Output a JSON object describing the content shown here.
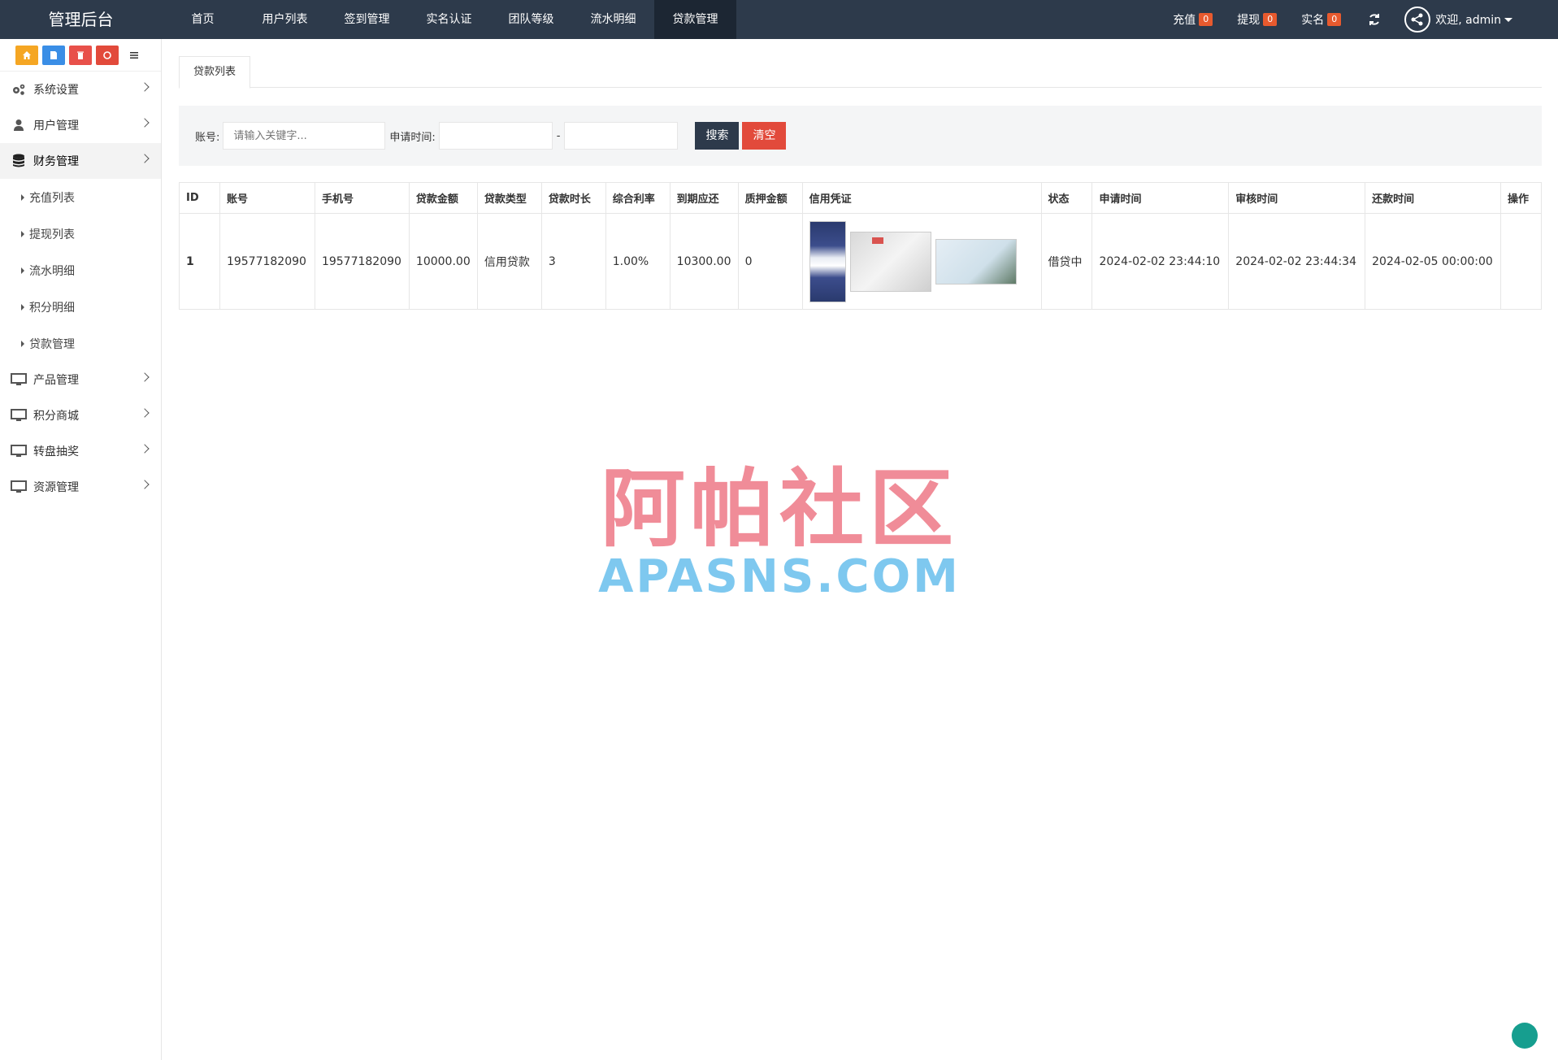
{
  "app": {
    "title": "管理后台"
  },
  "topnav": [
    {
      "label": "首页"
    },
    {
      "label": "用户列表"
    },
    {
      "label": "签到管理"
    },
    {
      "label": "实名认证"
    },
    {
      "label": "团队等级"
    },
    {
      "label": "流水明细"
    },
    {
      "label": "贷款管理",
      "active": true
    }
  ],
  "stats": [
    {
      "label": "充值",
      "count": "0"
    },
    {
      "label": "提现",
      "count": "0"
    },
    {
      "label": "实名",
      "count": "0"
    }
  ],
  "user": {
    "welcome": "欢迎, admin"
  },
  "sidebar": {
    "quick_buttons": [
      "home-icon",
      "file-icon",
      "trash-icon",
      "recycle-icon",
      "list-icon"
    ],
    "menu": [
      {
        "label": "系统设置",
        "icon": "gears-icon"
      },
      {
        "label": "用户管理",
        "icon": "user-icon"
      },
      {
        "label": "财务管理",
        "icon": "database-icon",
        "active": true
      },
      {
        "label": "产品管理",
        "icon": "monitor-icon"
      },
      {
        "label": "积分商城",
        "icon": "monitor-icon"
      },
      {
        "label": "转盘抽奖",
        "icon": "monitor-icon"
      },
      {
        "label": "资源管理",
        "icon": "monitor-icon"
      }
    ],
    "submenu": [
      {
        "label": "充值列表"
      },
      {
        "label": "提现列表"
      },
      {
        "label": "流水明细"
      },
      {
        "label": "积分明细"
      },
      {
        "label": "贷款管理"
      }
    ]
  },
  "tabs": [
    {
      "label": "贷款列表"
    }
  ],
  "search": {
    "account_label": "账号:",
    "account_placeholder": "请输入关键字...",
    "time_label": "申请时间:",
    "dash": "-",
    "search_button": "搜索",
    "clear_button": "清空"
  },
  "table": {
    "headers": [
      "ID",
      "账号",
      "手机号",
      "贷款金额",
      "贷款类型",
      "贷款时长",
      "综合利率",
      "到期应还",
      "质押金额",
      "信用凭证",
      "状态",
      "申请时间",
      "审核时间",
      "还款时间",
      "操作"
    ],
    "rows": [
      {
        "id": "1",
        "account": "19577182090",
        "phone": "19577182090",
        "amount": "10000.00",
        "type": "信用贷款",
        "duration": "3",
        "rate": "1.00%",
        "due": "10300.00",
        "pledge": "0",
        "status": "借贷中",
        "apply_time": "2024-02-02 23:44:10",
        "review_time": "2024-02-02 23:44:34",
        "repay_time": "2024-02-05 00:00:00",
        "action": ""
      }
    ]
  },
  "watermark": {
    "cn": "阿帕社区",
    "en": "APASNS.COM"
  },
  "colors": {
    "navbar": "#2d3a4b",
    "badge": "#e85a2e",
    "clear": "#e24a3b",
    "float": "#169e8f"
  }
}
